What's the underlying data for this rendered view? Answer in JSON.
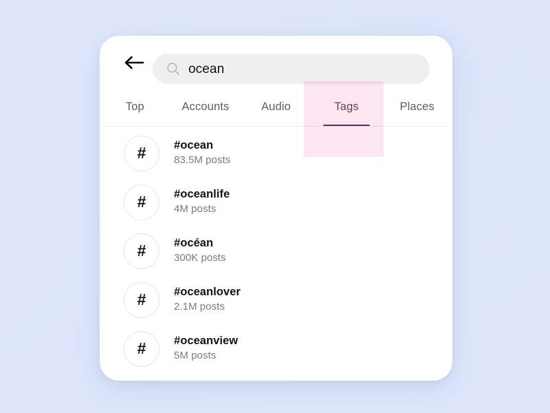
{
  "theme": {
    "page_background": "#dde6fb",
    "card_background": "#ffffff",
    "search_bar_background": "#efefef",
    "active_tab_color": "#5f4a58",
    "tab_underline_color": "#5c3a5a",
    "inactive_tab_color": "#5c5c61",
    "highlight_overlay_color": "#fce6f2",
    "title_color": "#131313",
    "subtitle_color": "#7b7b7b",
    "divider_color": "#ececec"
  },
  "header": {
    "back_icon": "arrow-left-icon",
    "search": {
      "icon": "search-icon",
      "value": "ocean",
      "placeholder": "Search"
    }
  },
  "tabs": {
    "active_index": 3,
    "items": [
      {
        "label": "Top"
      },
      {
        "label": "Accounts"
      },
      {
        "label": "Audio"
      },
      {
        "label": "Tags"
      },
      {
        "label": "Places"
      }
    ]
  },
  "results": {
    "avatar_icon": "hashtag-icon",
    "items": [
      {
        "icon": "#",
        "title": "#ocean",
        "subtitle": "83.5M posts"
      },
      {
        "icon": "#",
        "title": "#oceanlife",
        "subtitle": "4M posts"
      },
      {
        "icon": "#",
        "title": "#océan",
        "subtitle": "300K posts"
      },
      {
        "icon": "#",
        "title": "#oceanlover",
        "subtitle": "2.1M posts"
      },
      {
        "icon": "#",
        "title": "#oceanview",
        "subtitle": "5M posts"
      }
    ]
  }
}
